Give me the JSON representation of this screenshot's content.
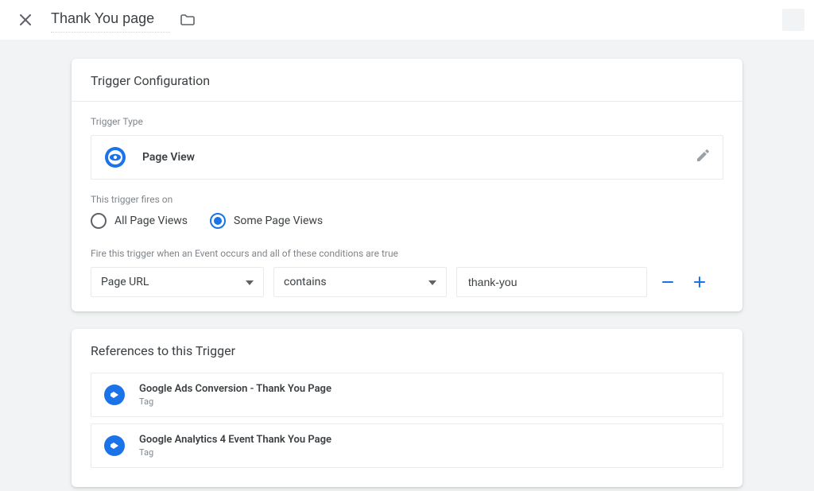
{
  "header": {
    "title_value": "Thank You page"
  },
  "trigger_config": {
    "section_title": "Trigger Configuration",
    "type_label": "Trigger Type",
    "type_value": "Page View",
    "fires_on_label": "This trigger fires on",
    "radio_all": "All Page Views",
    "radio_some": "Some Page Views",
    "selected_radio": "some",
    "condition_label": "Fire this trigger when an Event occurs and all of these conditions are true",
    "condition": {
      "variable": "Page URL",
      "operator": "contains",
      "value": "thank-you"
    }
  },
  "references": {
    "section_title": "References to this Trigger",
    "items": [
      {
        "title": "Google Ads Conversion - Thank You Page",
        "subtitle": "Tag"
      },
      {
        "title": "Google Analytics 4 Event Thank You Page",
        "subtitle": "Tag"
      }
    ]
  }
}
